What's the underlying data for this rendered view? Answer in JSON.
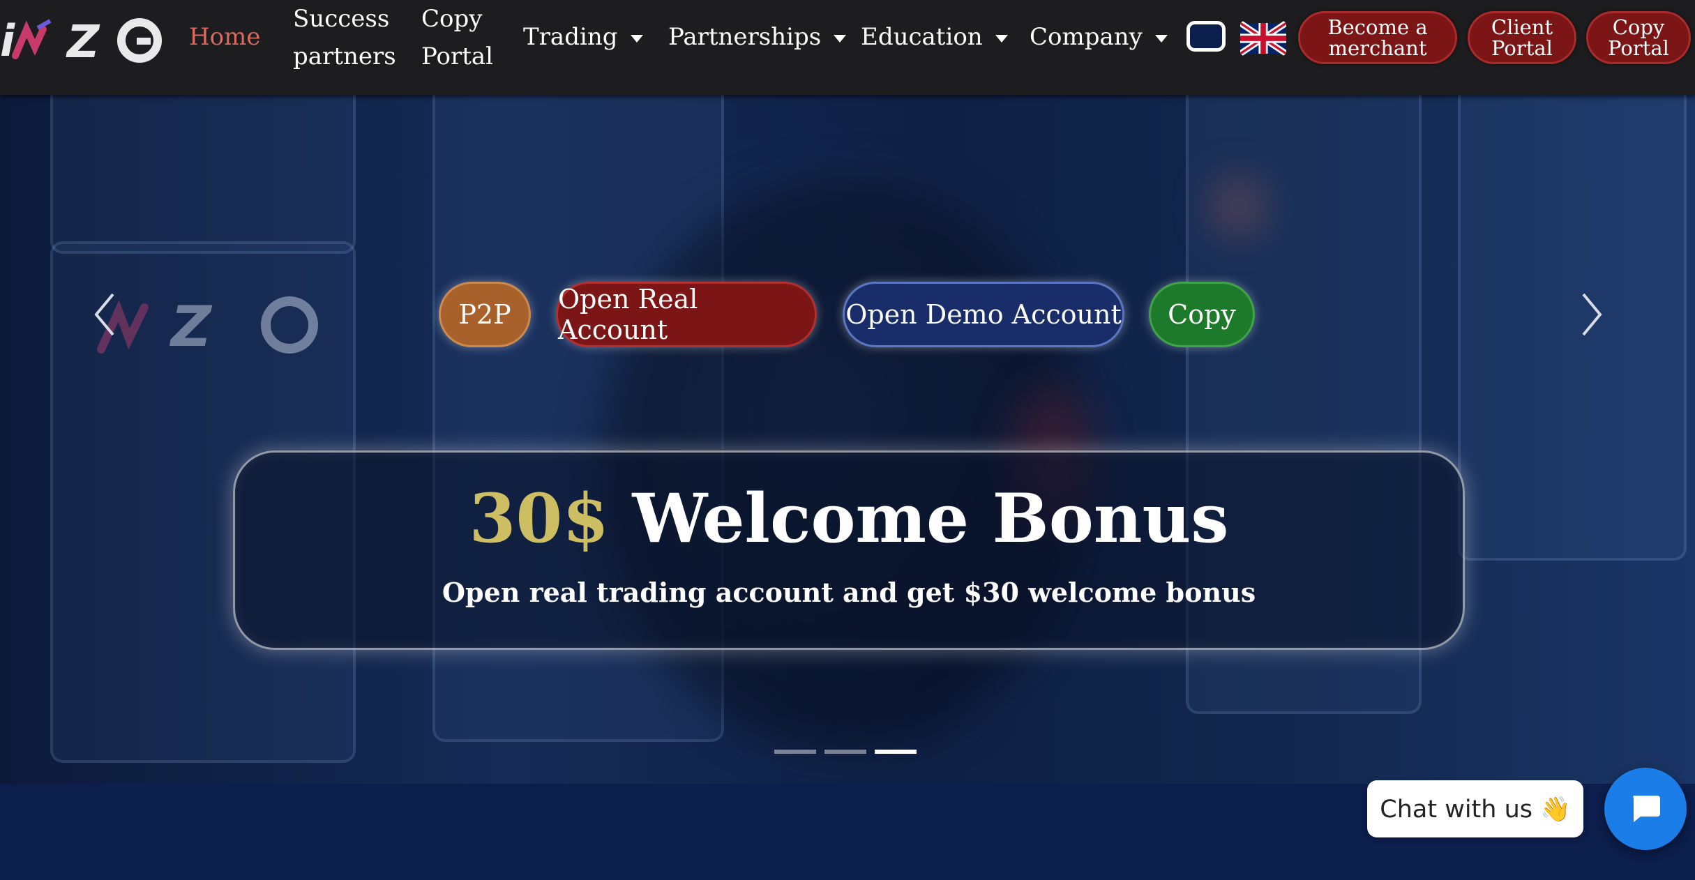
{
  "nav": {
    "logo_text": "INZO",
    "home": "Home",
    "success_line1": "Success",
    "success_line2": "partners",
    "copy_line1": "Copy",
    "copy_line2": "Portal",
    "trading": "Trading",
    "partnerships": "Partnerships",
    "education": "Education",
    "company": "Company",
    "language_flag": "uk-flag-icon",
    "buttons": {
      "merchant_line1": "Become a",
      "merchant_line2": "merchant",
      "client_line1": "Client",
      "client_line2": "Portal",
      "copyportal_line1": "Copy",
      "copyportal_line2": "Portal"
    }
  },
  "hero": {
    "cta": {
      "p2p": "P2P",
      "real": "Open Real Account",
      "demo": "Open Demo Account",
      "copy": "Copy"
    },
    "bonus": {
      "amount": "30$",
      "title": "Welcome Bonus",
      "subtitle": "Open real trading account and get $30 welcome bonus"
    },
    "slides": {
      "count": 3,
      "active_index": 2
    }
  },
  "chat": {
    "label": "Chat with us 👋"
  },
  "colors": {
    "nav_bg": "#1d1d1f",
    "home_active": "#d86a5f",
    "pill_red": "#7c1515",
    "p2p": "#a8612a",
    "real": "#7c1515",
    "demo": "#1a2d6b",
    "copy": "#1d7a2a",
    "bonus_amount": "#cdbd63",
    "chat_button": "#1a7de8",
    "page_bg": "#0c1e4c"
  }
}
